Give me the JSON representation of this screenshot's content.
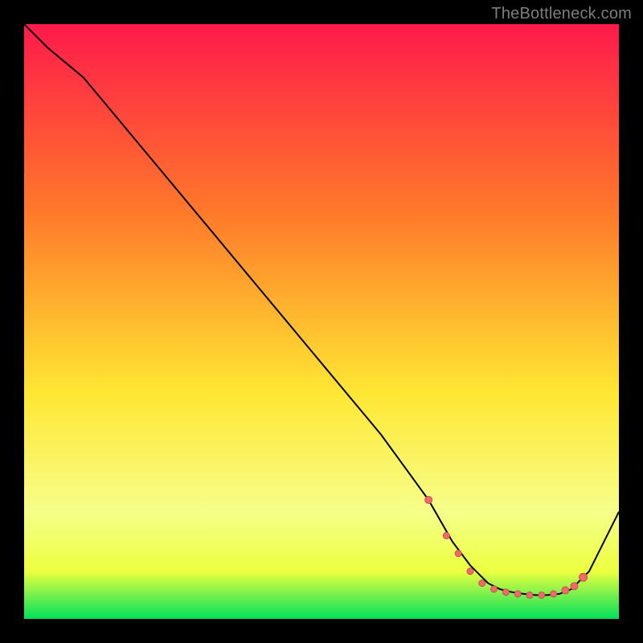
{
  "watermark": "TheBottleneck.com",
  "colors": {
    "gradient_top": "#ff1a4b",
    "gradient_mid1": "#ff7a2a",
    "gradient_mid2": "#ffe733",
    "gradient_mid3": "#f6ff8a",
    "gradient_band": "#ecff3f",
    "gradient_bottom": "#00e05a",
    "curve": "#000000",
    "dot_fill": "#ef6b6b",
    "dot_stroke": "#c94f4f"
  },
  "chart_data": {
    "type": "line",
    "title": "",
    "xlabel": "",
    "ylabel": "",
    "xlim": [
      0,
      100
    ],
    "ylim": [
      0,
      100
    ],
    "series": [
      {
        "name": "bottleneck-curve",
        "x": [
          0,
          4,
          10,
          20,
          30,
          40,
          50,
          60,
          68,
          72,
          75,
          78,
          80,
          82,
          84,
          86,
          88,
          90,
          92,
          95,
          100
        ],
        "y": [
          100,
          96,
          91,
          79,
          67,
          55,
          43,
          31,
          20,
          13,
          9,
          6,
          5,
          4.5,
          4.2,
          4,
          4,
          4.2,
          5,
          8,
          18
        ]
      }
    ],
    "markers": [
      {
        "x": 68,
        "y": 20,
        "r": 4.5
      },
      {
        "x": 71,
        "y": 14,
        "r": 4
      },
      {
        "x": 73,
        "y": 11,
        "r": 4
      },
      {
        "x": 75,
        "y": 8,
        "r": 4
      },
      {
        "x": 77,
        "y": 6,
        "r": 4
      },
      {
        "x": 79,
        "y": 5,
        "r": 4
      },
      {
        "x": 81,
        "y": 4.5,
        "r": 4
      },
      {
        "x": 83,
        "y": 4.2,
        "r": 4
      },
      {
        "x": 85,
        "y": 4,
        "r": 4
      },
      {
        "x": 87,
        "y": 4,
        "r": 4
      },
      {
        "x": 89,
        "y": 4.2,
        "r": 4
      },
      {
        "x": 91,
        "y": 4.8,
        "r": 4.5
      },
      {
        "x": 92.5,
        "y": 5.5,
        "r": 4.5
      },
      {
        "x": 94,
        "y": 7,
        "r": 5
      }
    ]
  }
}
